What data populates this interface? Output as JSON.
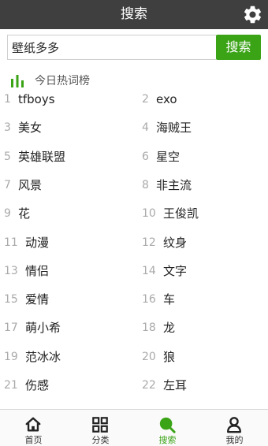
{
  "header": {
    "title": "搜索",
    "settings_icon": "gear-icon"
  },
  "search": {
    "value": "壁纸多多",
    "button_label": "搜索"
  },
  "hot_section": {
    "title": "今日热词榜",
    "icon": "bar-chart-icon",
    "accent_color": "#3aa316"
  },
  "hot_words": [
    {
      "rank": "1",
      "word": "tfboys"
    },
    {
      "rank": "2",
      "word": "exo"
    },
    {
      "rank": "3",
      "word": "美女"
    },
    {
      "rank": "4",
      "word": "海贼王"
    },
    {
      "rank": "5",
      "word": "英雄联盟"
    },
    {
      "rank": "6",
      "word": "星空"
    },
    {
      "rank": "7",
      "word": "风景"
    },
    {
      "rank": "8",
      "word": "非主流"
    },
    {
      "rank": "9",
      "word": "花"
    },
    {
      "rank": "10",
      "word": "王俊凯"
    },
    {
      "rank": "11",
      "word": "动漫"
    },
    {
      "rank": "12",
      "word": "纹身"
    },
    {
      "rank": "13",
      "word": "情侣"
    },
    {
      "rank": "14",
      "word": "文字"
    },
    {
      "rank": "15",
      "word": "爱情"
    },
    {
      "rank": "16",
      "word": "车"
    },
    {
      "rank": "17",
      "word": "萌小希"
    },
    {
      "rank": "18",
      "word": "龙"
    },
    {
      "rank": "19",
      "word": "范冰冰"
    },
    {
      "rank": "20",
      "word": "狼"
    },
    {
      "rank": "21",
      "word": "伤感"
    },
    {
      "rank": "22",
      "word": "左耳"
    }
  ],
  "tabs": [
    {
      "label": "首页",
      "icon": "home-icon"
    },
    {
      "label": "分类",
      "icon": "grid-icon"
    },
    {
      "label": "搜索",
      "icon": "search-icon",
      "active": true
    },
    {
      "label": "我的",
      "icon": "user-icon"
    }
  ],
  "colors": {
    "header_bg": "#3f3f3f",
    "accent": "#3aa316",
    "rank_gray": "#a9a9a9"
  }
}
